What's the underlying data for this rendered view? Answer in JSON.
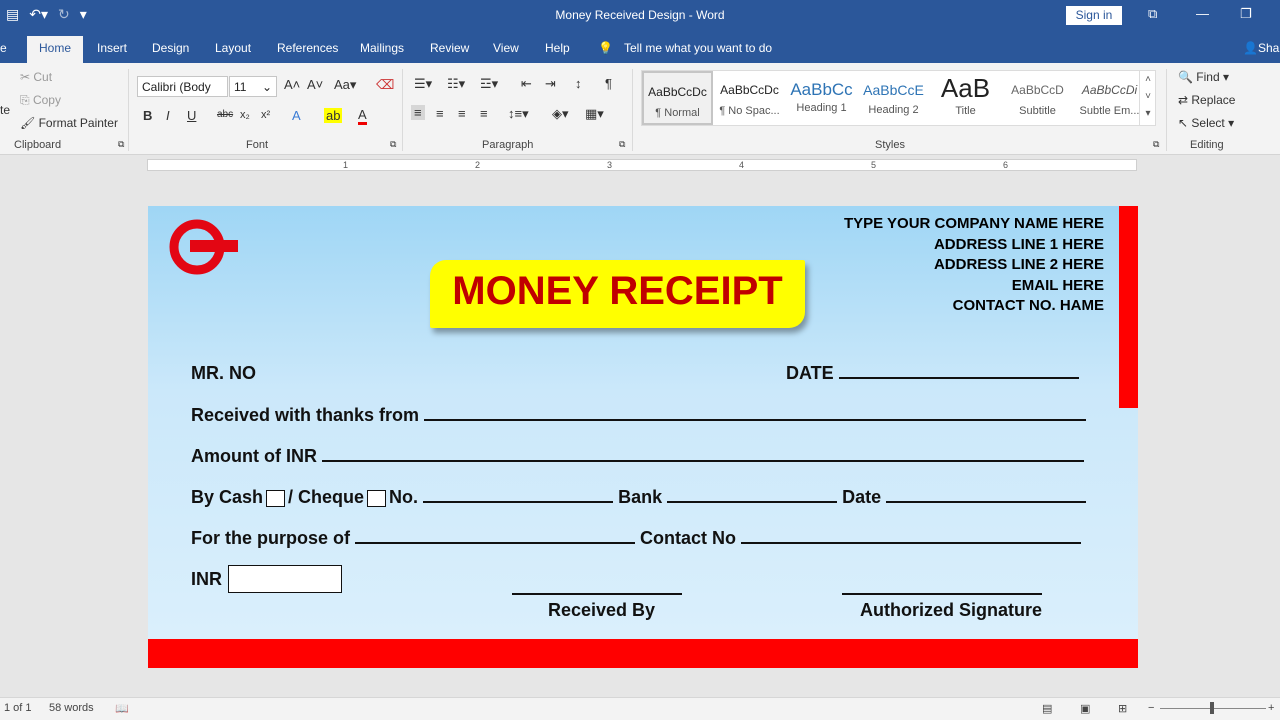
{
  "window": {
    "title": "Money Received Design  -  Word",
    "sign_in": "Sign in"
  },
  "tabs": [
    "Home",
    "Insert",
    "Design",
    "Layout",
    "References",
    "Mailings",
    "Review",
    "View",
    "Help"
  ],
  "tell_me": "Tell me what you want to do",
  "share": "Sha",
  "ribbon": {
    "clipboard": {
      "label": "Clipboard",
      "cut": "Cut",
      "copy": "Copy",
      "format_painter": "Format Painter",
      "paste": "te"
    },
    "font": {
      "label": "Font",
      "name": "Calibri (Body",
      "size": "11",
      "aa": "Aa"
    },
    "paragraph": {
      "label": "Paragraph"
    },
    "styles": {
      "label": "Styles",
      "items": [
        {
          "preview": "AaBbCcDc",
          "name": "¶ Normal"
        },
        {
          "preview": "AaBbCcDc",
          "name": "¶ No Spac..."
        },
        {
          "preview": "AaBbCc",
          "name": "Heading 1"
        },
        {
          "preview": "AaBbCcE",
          "name": "Heading 2"
        },
        {
          "preview": "AaB",
          "name": "Title"
        },
        {
          "preview": "AaBbCcD",
          "name": "Subtitle"
        },
        {
          "preview": "AaBbCcDi",
          "name": "Subtle Em..."
        }
      ]
    },
    "editing": {
      "label": "Editing",
      "find": "Find",
      "replace": "Replace",
      "select": "Select"
    }
  },
  "ruler_marks": [
    "1",
    "2",
    "3",
    "4",
    "5",
    "6"
  ],
  "document": {
    "company": [
      "TYPE YOUR COMPANY NAME HERE",
      "ADDRESS LINE 1 HERE",
      "ADDRESS LINE 2 HERE",
      "EMAIL HERE",
      "CONTACT NO. HAME"
    ],
    "banner": "MONEY RECEIPT",
    "mr_no": "MR. NO",
    "date": "DATE",
    "received_from": "Received with thanks from",
    "amount": "Amount of INR",
    "by_cash": "By Cash",
    "cheque": "/ Cheque",
    "no": "No.",
    "bank": "Bank",
    "date2": "Date",
    "purpose": "For the purpose of",
    "contact": "Contact No",
    "inr": "INR",
    "received_by": "Received By",
    "authorized": "Authorized Signature",
    "colors": {
      "banner_bg": "#ffff00",
      "banner_text": "#c00000",
      "accent_red": "#ff0000",
      "page_bg": "#cbe8fa"
    }
  },
  "status": {
    "page": "1 of 1",
    "words": "58 words"
  }
}
